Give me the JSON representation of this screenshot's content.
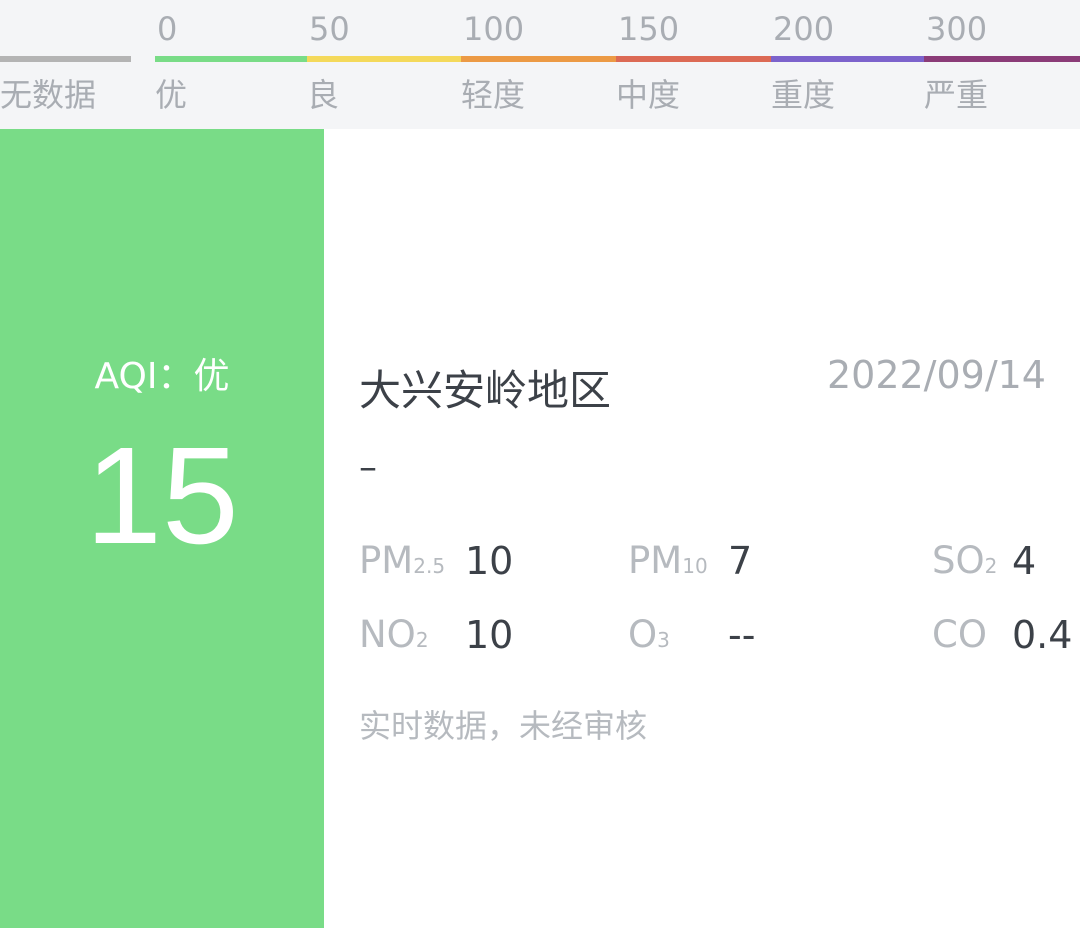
{
  "legend": {
    "nodata_label": "无数据",
    "nodata_color": "#b4b4b4",
    "levels": [
      {
        "value": "0",
        "label": "优",
        "color": "#79dc87"
      },
      {
        "value": "50",
        "label": "良",
        "color": "#f4d95b"
      },
      {
        "value": "100",
        "label": "轻度",
        "color": "#ec9a45"
      },
      {
        "value": "150",
        "label": "中度",
        "color": "#dc6a55"
      },
      {
        "value": "200",
        "label": "重度",
        "color": "#7c63cc"
      },
      {
        "value": "300",
        "label": "严重",
        "color": "#8b3c78"
      }
    ]
  },
  "aqi": {
    "level_text": "AQI：优",
    "value": "15",
    "color": "#79dc87"
  },
  "station": {
    "region": "大兴安岭地区",
    "date": "2022/09/14",
    "primary_pollutant": "–"
  },
  "pollutants": {
    "pm25": {
      "name": "PM",
      "sub": "2.5",
      "value": "10"
    },
    "pm10": {
      "name": "PM",
      "sub": "10",
      "value": "7"
    },
    "so2": {
      "name": "SO",
      "sub": "2",
      "value": "4"
    },
    "no2": {
      "name": "NO",
      "sub": "2",
      "value": "10"
    },
    "o3": {
      "name": "O",
      "sub": "3",
      "value": "--"
    },
    "co": {
      "name": "CO",
      "sub": "",
      "value": "0.4"
    }
  },
  "note": "实时数据，未经审核"
}
